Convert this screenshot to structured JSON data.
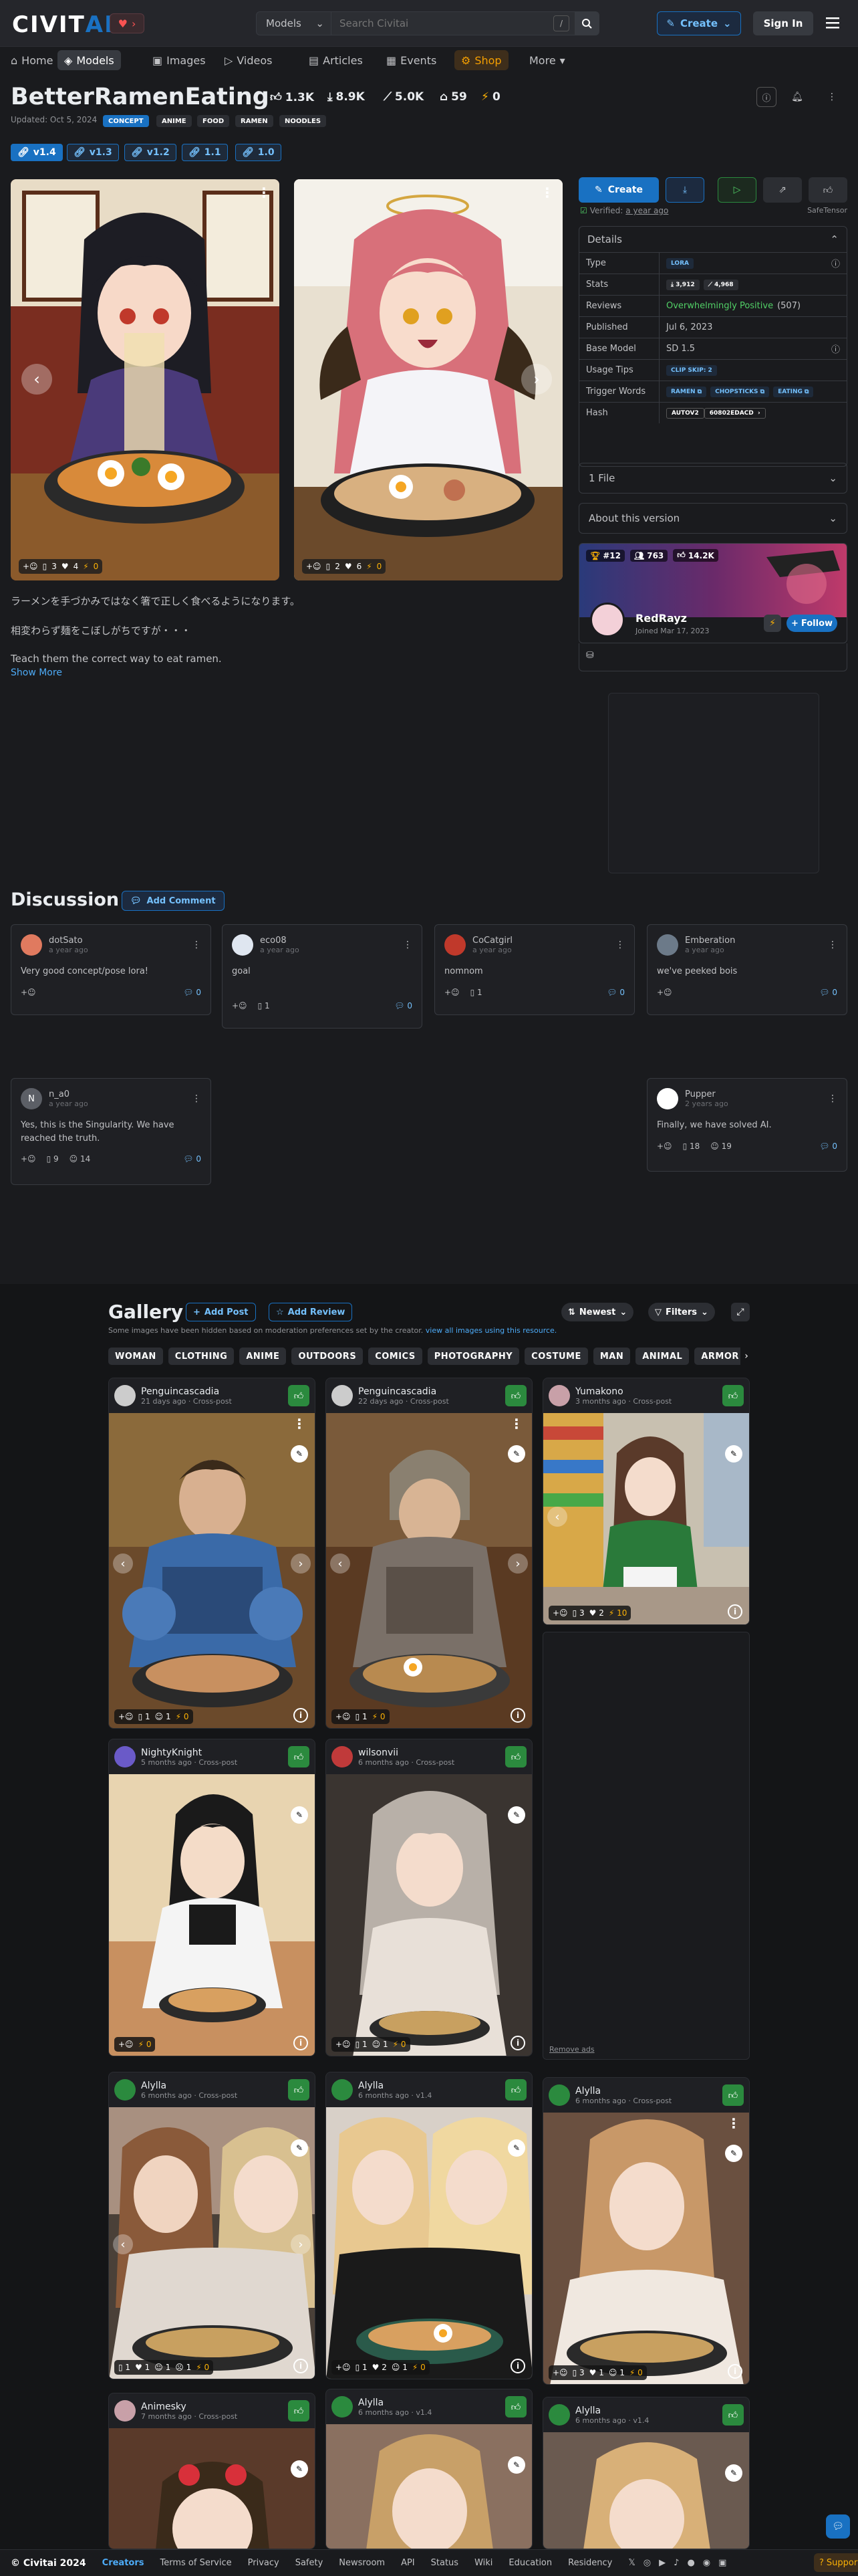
{
  "header": {
    "logo_a": "CIVIT",
    "logo_b": "AI",
    "search_type": "Models",
    "search_placeholder": "Search Civitai",
    "kbd": "/",
    "create": "Create",
    "signin": "Sign In"
  },
  "nav": [
    "Home",
    "Models",
    "Images",
    "Videos",
    "Articles",
    "Events",
    "Shop",
    "More"
  ],
  "model": {
    "title": "BetterRamenEating",
    "stats": {
      "likes": "1.3K",
      "downloads": "8.9K",
      "generations": "5.0K",
      "collections": "59",
      "buzz": "0"
    },
    "updated": "Updated: Oct 5, 2024",
    "tags": [
      "CONCEPT",
      "ANIME",
      "FOOD",
      "RAMEN",
      "NOODLES"
    ],
    "versions": [
      "v1.4",
      "v1.3",
      "v1.2",
      "1.1",
      "1.0"
    ]
  },
  "showcase": [
    {
      "reactions": "3",
      "hearts": "4",
      "buzz": "0"
    },
    {
      "reactions": "2",
      "hearts": "6",
      "buzz": "0"
    }
  ],
  "description": {
    "line1": "ラーメンを手づかみではなく箸で正しく食べるようになります。",
    "line2": "相変わらず麺をこぼしがちですが・・・",
    "line3": "Teach them the correct way to eat ramen.",
    "more": "Show More"
  },
  "sidebar": {
    "create": "Create",
    "verified": "Verified:",
    "verified_when": "a year ago",
    "safetensor": "SafeTensor",
    "details_title": "Details",
    "rows": [
      {
        "k": "Type",
        "v": "LORA"
      },
      {
        "k": "Stats",
        "v1": "3,912",
        "v2": "4,968"
      },
      {
        "k": "Reviews",
        "v": "Overwhelmingly Positive",
        "count": "(507)"
      },
      {
        "k": "Published",
        "v": "Jul 6, 2023"
      },
      {
        "k": "Base Model",
        "v": "SD 1.5"
      },
      {
        "k": "Usage Tips",
        "v": "CLIP SKIP: 2"
      },
      {
        "k": "Trigger Words",
        "t1": "RAMEN",
        "t2": "CHOPSTICKS",
        "t3": "EATING"
      },
      {
        "k": "Hash",
        "h1": "AUTOV2",
        "h2": "60802EDACD"
      }
    ],
    "files": "1 File",
    "about": "About this version",
    "creator": {
      "rank": "#12",
      "followers": "763",
      "likes": "14.2K",
      "name": "RedRayz",
      "joined": "Joined Mar 17, 2023",
      "follow": "Follow"
    }
  },
  "discussion": {
    "title": "Discussion",
    "add": "Add Comment",
    "comments": [
      {
        "name": "dotSato",
        "date": "a year ago",
        "text": "Very good concept/pose lora!",
        "img": "",
        "replies": "0"
      },
      {
        "name": "eco08",
        "date": "a year ago",
        "text": "goal",
        "img": "1",
        "replies": "0"
      },
      {
        "name": "CoCatgirl",
        "date": "a year ago",
        "text": "nomnom",
        "img": "1",
        "replies": "0"
      },
      {
        "name": "Emberation",
        "date": "a year ago",
        "text": "we've peeked bois",
        "img": "",
        "replies": "0"
      },
      {
        "name": "n_a0",
        "date": "a year ago",
        "text": "Yes, this is the Singularity. We have reached the truth.",
        "img": "9",
        "laugh": "14",
        "replies": "0",
        "initial": "N"
      },
      {
        "name": "Pupper",
        "date": "2 years ago",
        "text": "Finally, we have solved AI.",
        "img": "18",
        "laugh": "19",
        "replies": "0"
      }
    ]
  },
  "gallery": {
    "title": "Gallery",
    "add_post": "Add Post",
    "add_review": "Add Review",
    "sort": "Newest",
    "filters": "Filters",
    "note": "Some images have been hidden based on moderation preferences set by the creator.",
    "note_link": "view all images using this resource.",
    "chips": [
      "WOMAN",
      "CLOTHING",
      "ANIME",
      "OUTDOORS",
      "COMICS",
      "PHOTOGRAPHY",
      "COSTUME",
      "MAN",
      "ANIMAL",
      "ARMOR"
    ],
    "remove_ads": "Remove ads",
    "cards": [
      {
        "name": "Penguincascadia",
        "sub": "21 days ago · Cross-post",
        "f": [
          "1",
          "1",
          "0"
        ]
      },
      {
        "name": "Penguincascadia",
        "sub": "22 days ago · Cross-post",
        "f": [
          "1",
          "0"
        ]
      },
      {
        "name": "Yumakono",
        "sub": "3 months ago · Cross-post",
        "f": [
          "3",
          "2",
          "10"
        ]
      },
      {
        "name": "NightyKnight",
        "sub": "5 months ago · Cross-post",
        "f": [
          "0"
        ]
      },
      {
        "name": "wilsonvii",
        "sub": "6 months ago · Cross-post",
        "f": [
          "1",
          "1",
          "0"
        ]
      },
      {
        "name": "Alylla",
        "sub": "6 months ago · Cross-post",
        "f": [
          "1",
          "1",
          "1",
          "1",
          "0"
        ]
      },
      {
        "name": "Alylla",
        "sub": "6 months ago · v1.4",
        "f": [
          "1",
          "2",
          "1",
          "0"
        ]
      },
      {
        "name": "Alylla",
        "sub": "6 months ago · Cross-post",
        "f": [
          "3",
          "1",
          "1",
          "0"
        ]
      },
      {
        "name": "Animesky",
        "sub": "7 months ago · Cross-post",
        "f": []
      },
      {
        "name": "Alylla",
        "sub": "6 months ago · v1.4",
        "f": []
      },
      {
        "name": "Alylla",
        "sub": "6 months ago · v1.4",
        "f": []
      }
    ]
  },
  "footer": {
    "copy": "© Civitai 2024",
    "links": [
      "Creators",
      "Terms of Service",
      "Privacy",
      "Safety",
      "Newsroom",
      "API",
      "Status",
      "Wiki",
      "Education",
      "Residency"
    ],
    "support": "Support"
  }
}
